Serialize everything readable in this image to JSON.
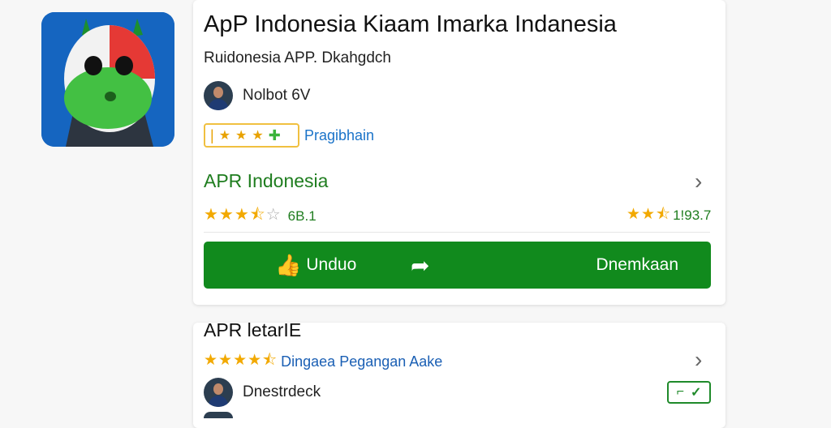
{
  "app": {
    "title": "ApP Indonesia Kiaam Imarka Indanesia",
    "subtitle": "Ruidonesia APP. Dkahgdch",
    "developer": "Nolbot 6V",
    "badge_label": "Pragibhain",
    "icon": "app-mascot-icon"
  },
  "section1": {
    "title": "APR Indonesia",
    "rating_left": "6B.1",
    "rating_right": "1!93.7",
    "stars_left": "3.5 of 5",
    "chevron": "chevron-right-icon"
  },
  "actions": {
    "download_label": "Unduo",
    "share_icon": "share-arrow-icon",
    "right_label": "Dnemkaan"
  },
  "section2": {
    "title": "APR letarIE",
    "link_text": "Dingaea Pegangan Aake",
    "developer": "Dnestrdeck",
    "install_badge": "install-icon"
  },
  "colors": {
    "accent_green": "#118a1d",
    "text_green": "#1f7d1f",
    "star_gold": "#f2a900",
    "link_blue": "#1a73c9"
  }
}
